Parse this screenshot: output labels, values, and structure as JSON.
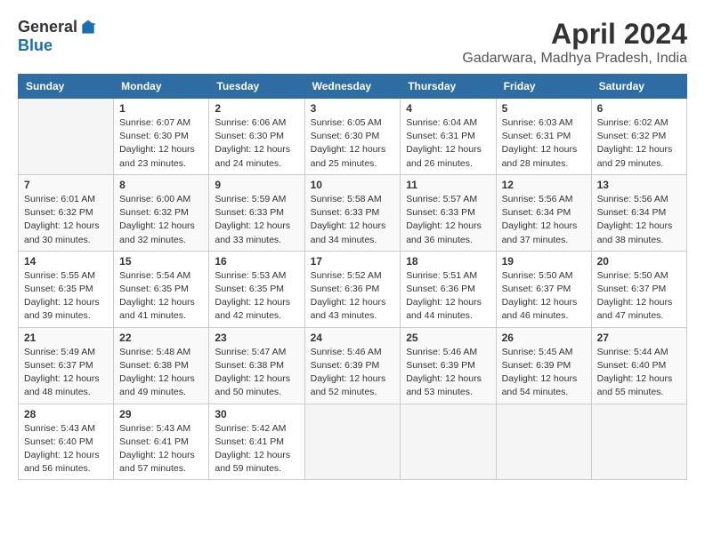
{
  "header": {
    "logo_general": "General",
    "logo_blue": "Blue",
    "month_title": "April 2024",
    "location": "Gadarwara, Madhya Pradesh, India"
  },
  "weekdays": [
    "Sunday",
    "Monday",
    "Tuesday",
    "Wednesday",
    "Thursday",
    "Friday",
    "Saturday"
  ],
  "weeks": [
    [
      {
        "day": "",
        "info": ""
      },
      {
        "day": "1",
        "info": "Sunrise: 6:07 AM\nSunset: 6:30 PM\nDaylight: 12 hours\nand 23 minutes."
      },
      {
        "day": "2",
        "info": "Sunrise: 6:06 AM\nSunset: 6:30 PM\nDaylight: 12 hours\nand 24 minutes."
      },
      {
        "day": "3",
        "info": "Sunrise: 6:05 AM\nSunset: 6:30 PM\nDaylight: 12 hours\nand 25 minutes."
      },
      {
        "day": "4",
        "info": "Sunrise: 6:04 AM\nSunset: 6:31 PM\nDaylight: 12 hours\nand 26 minutes."
      },
      {
        "day": "5",
        "info": "Sunrise: 6:03 AM\nSunset: 6:31 PM\nDaylight: 12 hours\nand 28 minutes."
      },
      {
        "day": "6",
        "info": "Sunrise: 6:02 AM\nSunset: 6:32 PM\nDaylight: 12 hours\nand 29 minutes."
      }
    ],
    [
      {
        "day": "7",
        "info": "Sunrise: 6:01 AM\nSunset: 6:32 PM\nDaylight: 12 hours\nand 30 minutes."
      },
      {
        "day": "8",
        "info": "Sunrise: 6:00 AM\nSunset: 6:32 PM\nDaylight: 12 hours\nand 32 minutes."
      },
      {
        "day": "9",
        "info": "Sunrise: 5:59 AM\nSunset: 6:33 PM\nDaylight: 12 hours\nand 33 minutes."
      },
      {
        "day": "10",
        "info": "Sunrise: 5:58 AM\nSunset: 6:33 PM\nDaylight: 12 hours\nand 34 minutes."
      },
      {
        "day": "11",
        "info": "Sunrise: 5:57 AM\nSunset: 6:33 PM\nDaylight: 12 hours\nand 36 minutes."
      },
      {
        "day": "12",
        "info": "Sunrise: 5:56 AM\nSunset: 6:34 PM\nDaylight: 12 hours\nand 37 minutes."
      },
      {
        "day": "13",
        "info": "Sunrise: 5:56 AM\nSunset: 6:34 PM\nDaylight: 12 hours\nand 38 minutes."
      }
    ],
    [
      {
        "day": "14",
        "info": "Sunrise: 5:55 AM\nSunset: 6:35 PM\nDaylight: 12 hours\nand 39 minutes."
      },
      {
        "day": "15",
        "info": "Sunrise: 5:54 AM\nSunset: 6:35 PM\nDaylight: 12 hours\nand 41 minutes."
      },
      {
        "day": "16",
        "info": "Sunrise: 5:53 AM\nSunset: 6:35 PM\nDaylight: 12 hours\nand 42 minutes."
      },
      {
        "day": "17",
        "info": "Sunrise: 5:52 AM\nSunset: 6:36 PM\nDaylight: 12 hours\nand 43 minutes."
      },
      {
        "day": "18",
        "info": "Sunrise: 5:51 AM\nSunset: 6:36 PM\nDaylight: 12 hours\nand 44 minutes."
      },
      {
        "day": "19",
        "info": "Sunrise: 5:50 AM\nSunset: 6:37 PM\nDaylight: 12 hours\nand 46 minutes."
      },
      {
        "day": "20",
        "info": "Sunrise: 5:50 AM\nSunset: 6:37 PM\nDaylight: 12 hours\nand 47 minutes."
      }
    ],
    [
      {
        "day": "21",
        "info": "Sunrise: 5:49 AM\nSunset: 6:37 PM\nDaylight: 12 hours\nand 48 minutes."
      },
      {
        "day": "22",
        "info": "Sunrise: 5:48 AM\nSunset: 6:38 PM\nDaylight: 12 hours\nand 49 minutes."
      },
      {
        "day": "23",
        "info": "Sunrise: 5:47 AM\nSunset: 6:38 PM\nDaylight: 12 hours\nand 50 minutes."
      },
      {
        "day": "24",
        "info": "Sunrise: 5:46 AM\nSunset: 6:39 PM\nDaylight: 12 hours\nand 52 minutes."
      },
      {
        "day": "25",
        "info": "Sunrise: 5:46 AM\nSunset: 6:39 PM\nDaylight: 12 hours\nand 53 minutes."
      },
      {
        "day": "26",
        "info": "Sunrise: 5:45 AM\nSunset: 6:39 PM\nDaylight: 12 hours\nand 54 minutes."
      },
      {
        "day": "27",
        "info": "Sunrise: 5:44 AM\nSunset: 6:40 PM\nDaylight: 12 hours\nand 55 minutes."
      }
    ],
    [
      {
        "day": "28",
        "info": "Sunrise: 5:43 AM\nSunset: 6:40 PM\nDaylight: 12 hours\nand 56 minutes."
      },
      {
        "day": "29",
        "info": "Sunrise: 5:43 AM\nSunset: 6:41 PM\nDaylight: 12 hours\nand 57 minutes."
      },
      {
        "day": "30",
        "info": "Sunrise: 5:42 AM\nSunset: 6:41 PM\nDaylight: 12 hours\nand 59 minutes."
      },
      {
        "day": "",
        "info": ""
      },
      {
        "day": "",
        "info": ""
      },
      {
        "day": "",
        "info": ""
      },
      {
        "day": "",
        "info": ""
      }
    ]
  ]
}
